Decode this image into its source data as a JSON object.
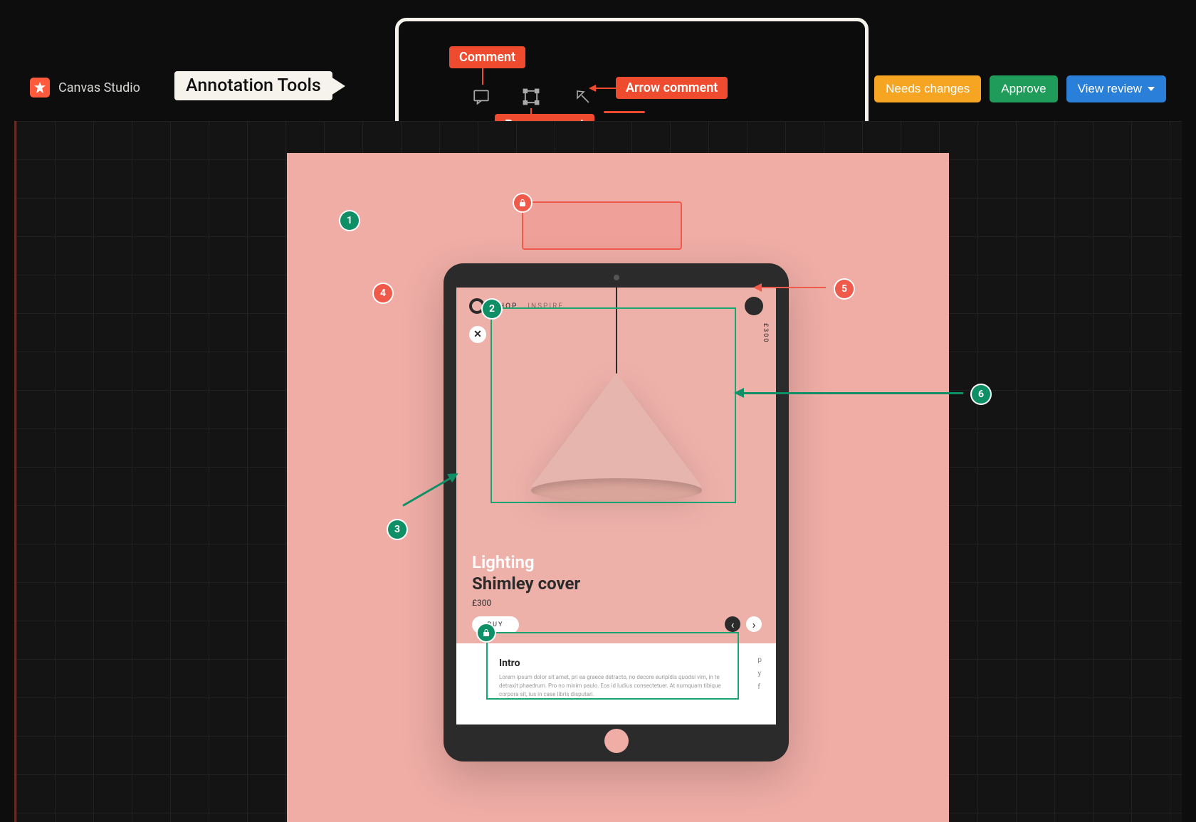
{
  "brand": {
    "name": "Canvas Studio"
  },
  "annotation_label": "Annotation Tools",
  "tools": {
    "comment_label": "Comment",
    "box_label": "Box comment",
    "arrow_label": "Arrow comment"
  },
  "actions": {
    "needs_changes": "Needs changes",
    "approve": "Approve",
    "view_review": "View review"
  },
  "mockup": {
    "nav_shop": "SHOP",
    "nav_inspire": "INSPIRE",
    "price_vertical": "£300",
    "category": "Lighting",
    "product_name": "Shimley cover",
    "price": "£300",
    "buy_label": "BUY",
    "intro_title": "Intro",
    "intro_text": "Lorem ipsum dolor sit amet, pri ea graece detracto, no decore euripidis quodsi vim, in te detraxit phaedrum. Pro no minim paulo. Eos id ludius consectetuer. At numquam tibique corpora sit, ius in case libris disputari."
  },
  "pins": {
    "p1": "1",
    "p2": "2",
    "p3": "3",
    "p4": "4",
    "p5": "5",
    "p6": "6"
  }
}
